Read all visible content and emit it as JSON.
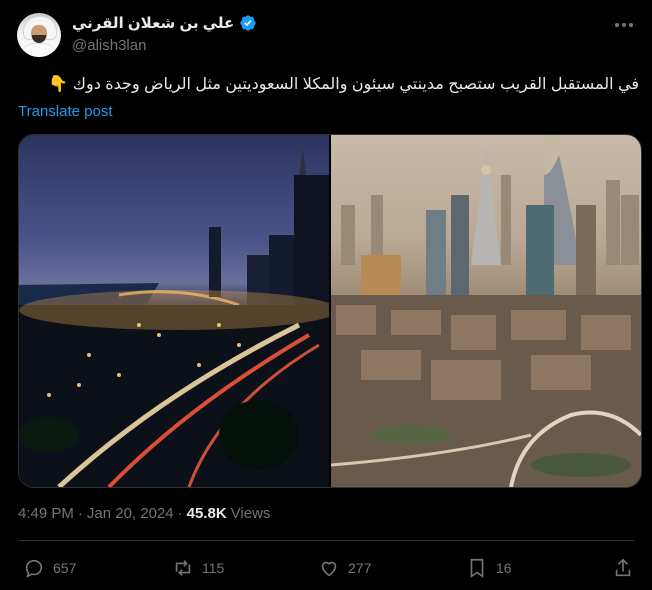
{
  "author": {
    "display_name": "علي بن شعلان القرني",
    "handle": "@alish3lan",
    "verified": true
  },
  "post": {
    "text": "في المستقبل القريب ستصبح مدينتي سيئون والمكلا السعوديتين مثل الرياض وجدة دوك 👇",
    "translate_label": "Translate post"
  },
  "meta": {
    "time": "4:49 PM",
    "separator": "·",
    "date": "Jan 20, 2024",
    "separator2": "·",
    "views_count": "45.8K",
    "views_label": "Views"
  },
  "actions": {
    "replies": "657",
    "reposts": "115",
    "likes": "277",
    "bookmarks": "16"
  },
  "colors": {
    "background": "#000000",
    "text": "#e7e9ea",
    "muted": "#71767b",
    "accent": "#1d9bf0",
    "border": "#2f3336"
  },
  "icons": {
    "verified": "verified-badge-icon",
    "more": "more-horizontal-icon",
    "reply": "reply-icon",
    "repost": "repost-icon",
    "like": "heart-icon",
    "bookmark": "bookmark-icon",
    "share": "share-icon"
  }
}
